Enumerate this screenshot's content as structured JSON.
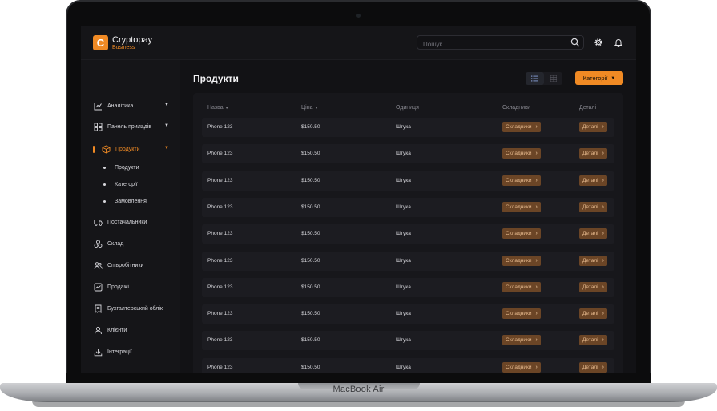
{
  "device": {
    "label": "MacBook Air"
  },
  "brand": {
    "name": "Cryptopay",
    "sub": "Business",
    "logo_letter": "C",
    "accent": "#f08a24"
  },
  "search": {
    "placeholder": "Пошук",
    "value": ""
  },
  "sidebar": {
    "items": [
      {
        "label": "Аналітика",
        "icon": "chart-icon",
        "expandable": true
      },
      {
        "label": "Панель приладів",
        "icon": "dashboard-icon",
        "expandable": true
      },
      {
        "label": "Продукти",
        "icon": "box-icon",
        "expandable": true,
        "active": true
      },
      {
        "label": "Постачальники",
        "icon": "truck-icon"
      },
      {
        "label": "Склад",
        "icon": "boxes-icon"
      },
      {
        "label": "Співробітники",
        "icon": "users-icon"
      },
      {
        "label": "Продажі",
        "icon": "sales-chart-icon"
      },
      {
        "label": "Бухгалтерський облік",
        "icon": "receipt-icon"
      },
      {
        "label": "Клієнти",
        "icon": "user-icon"
      },
      {
        "label": "Інтеграції",
        "icon": "download-icon"
      }
    ],
    "subitems": [
      {
        "label": "Продукти"
      },
      {
        "label": "Категорії"
      },
      {
        "label": "Замовлення"
      }
    ]
  },
  "main": {
    "title": "Продукти",
    "category_button": "Категорії",
    "columns": [
      "Назва",
      "Ціна",
      "Одиниця",
      "Складники",
      "Деталі"
    ],
    "rows": [
      {
        "name": "Phone 123",
        "price": "$150.50",
        "unit": "Штука",
        "components": "Складники",
        "details": "Деталі"
      },
      {
        "name": "Phone 123",
        "price": "$150.50",
        "unit": "Штука",
        "components": "Складники",
        "details": "Деталі"
      },
      {
        "name": "Phone 123",
        "price": "$150.50",
        "unit": "Штука",
        "components": "Складники",
        "details": "Деталі"
      },
      {
        "name": "Phone 123",
        "price": "$150.50",
        "unit": "Штука",
        "components": "Складники",
        "details": "Деталі"
      },
      {
        "name": "Phone 123",
        "price": "$150.50",
        "unit": "Штука",
        "components": "Складники",
        "details": "Деталі"
      },
      {
        "name": "Phone 123",
        "price": "$150.50",
        "unit": "Штука",
        "components": "Складники",
        "details": "Деталі"
      },
      {
        "name": "Phone 123",
        "price": "$150.50",
        "unit": "Штука",
        "components": "Складники",
        "details": "Деталі"
      },
      {
        "name": "Phone 123",
        "price": "$150.50",
        "unit": "Штука",
        "components": "Складники",
        "details": "Деталі"
      },
      {
        "name": "Phone 123",
        "price": "$150.50",
        "unit": "Штука",
        "components": "Складники",
        "details": "Деталі"
      },
      {
        "name": "Phone 123",
        "price": "$150.50",
        "unit": "Штука",
        "components": "Складники",
        "details": "Деталі"
      }
    ]
  }
}
